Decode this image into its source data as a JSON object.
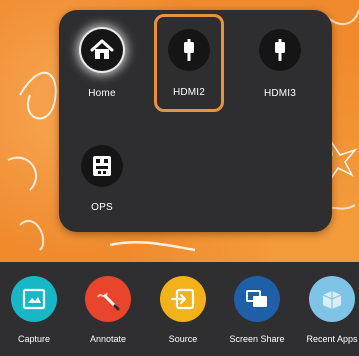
{
  "source_panel": {
    "tiles": [
      {
        "label": "Home",
        "icon": "home-icon"
      },
      {
        "label": "HDMI2",
        "icon": "hdmi-icon",
        "selected": true
      },
      {
        "label": "HDMI3",
        "icon": "hdmi-icon"
      },
      {
        "label": "OPS",
        "icon": "ops-icon"
      }
    ]
  },
  "dock": {
    "items": [
      {
        "label": "Capture",
        "icon": "capture-icon",
        "color": "#18b7c6"
      },
      {
        "label": "Annotate",
        "icon": "annotate-icon",
        "color": "#e8452c"
      },
      {
        "label": "Source",
        "icon": "source-icon",
        "color": "#f2b21a"
      },
      {
        "label": "Screen Share",
        "icon": "screen-share-icon",
        "color": "#1f5fa8"
      },
      {
        "label": "Recent Apps",
        "icon": "recent-apps-icon",
        "color": "#7fc4e6"
      }
    ]
  },
  "colors": {
    "selection_border": "#e8913f",
    "panel_bg": "#2e2e30",
    "wallpaper": "#ef8a2d"
  }
}
